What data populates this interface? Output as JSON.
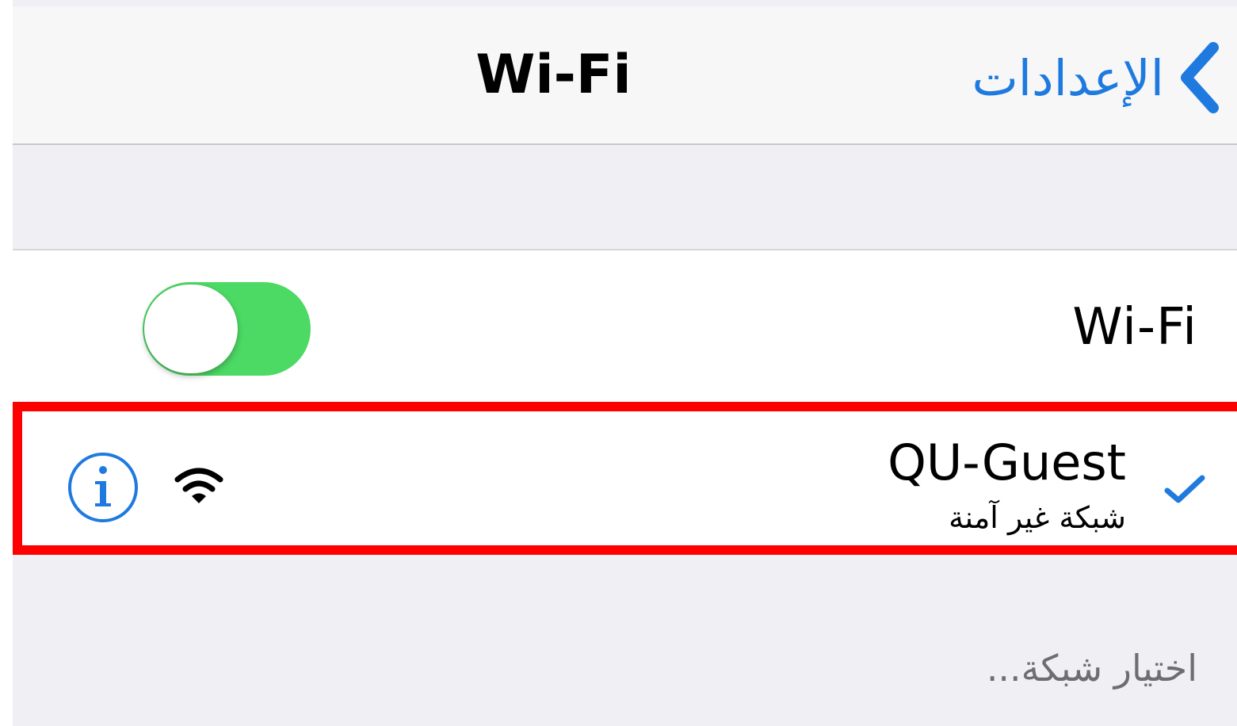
{
  "navbar": {
    "title": "Wi-Fi",
    "back_label": "الإعدادات",
    "back_icon": "chevron-left-icon"
  },
  "wifi_toggle": {
    "label": "Wi-Fi",
    "state": "on"
  },
  "connected_network": {
    "name": "QU-Guest",
    "subtitle": "شبكة غير آمنة",
    "checkmark_icon": "checkmark-icon",
    "signal_icon": "wifi-signal-icon",
    "info_icon": "info-icon",
    "highlight_color": "#ff0000"
  },
  "choose_network": {
    "label": "اختيار شبكة..."
  },
  "colors": {
    "accent": "#1f7ae0",
    "toggle_on": "#4cd964",
    "background": "#efeff4"
  }
}
